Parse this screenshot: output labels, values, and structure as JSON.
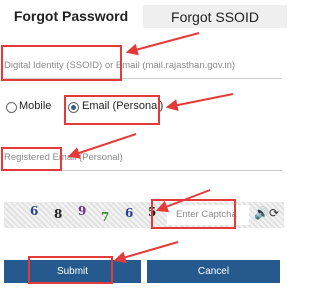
{
  "tabs": {
    "forgot_password": "Forgot Password",
    "forgot_ssoid": "Forgot SSOID"
  },
  "identity_field": {
    "placeholder": "Digital Identity (SSOID) or Email (mail.rajasthan.gov.in)"
  },
  "radio": {
    "mobile_label": "Mobile",
    "email_label": "Email (Personal)",
    "selected": "Email (Personal)"
  },
  "email_field": {
    "placeholder": "Registered Email (Personal)"
  },
  "captcha": {
    "chars": [
      "6",
      "8",
      "9",
      "7",
      "6",
      "5"
    ],
    "char_colors": [
      "#2a3f8f",
      "#222222",
      "#6a2c91",
      "#3c8d3c",
      "#2a3f8f",
      "#222222"
    ],
    "input_placeholder": "Enter Captcha",
    "audio_icon": "speaker-icon",
    "refresh_icon": "refresh-icon"
  },
  "buttons": {
    "submit": "Submit",
    "cancel": "Cancel"
  },
  "colors": {
    "button_bg": "#265a8f",
    "highlight": "#e53a3a"
  }
}
